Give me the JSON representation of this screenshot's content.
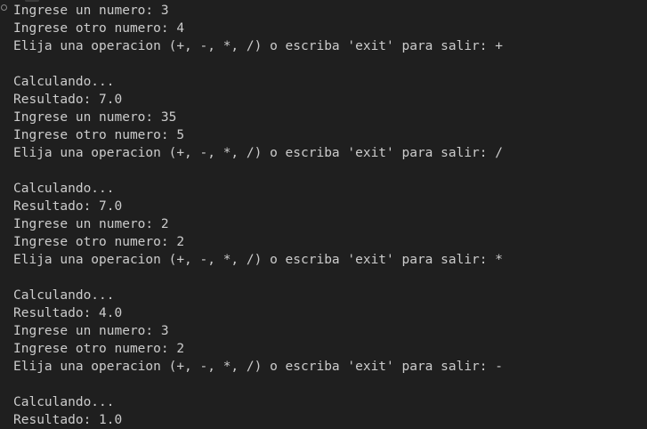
{
  "terminal": {
    "lines": [
      "Ingrese un numero: 3",
      "Ingrese otro numero: 4",
      "Elija una operacion (+, -, *, /) o escriba 'exit' para salir: +",
      "",
      "Calculando...",
      "Resultado: 7.0",
      "Ingrese un numero: 35",
      "Ingrese otro numero: 5",
      "Elija una operacion (+, -, *, /) o escriba 'exit' para salir: /",
      "",
      "Calculando...",
      "Resultado: 7.0",
      "Ingrese un numero: 2",
      "Ingrese otro numero: 2",
      "Elija una operacion (+, -, *, /) o escriba 'exit' para salir: *",
      "",
      "Calculando...",
      "Resultado: 4.0",
      "Ingrese un numero: 3",
      "Ingrese otro numero: 2",
      "Elija una operacion (+, -, *, /) o escriba 'exit' para salir: -",
      "",
      "Calculando...",
      "Resultado: 1.0"
    ],
    "colors": {
      "background": "#1f1f1f",
      "foreground": "#cccccc",
      "marker": "#8a8a8a"
    },
    "marker_icon": "command-decoration-circle-icon"
  }
}
